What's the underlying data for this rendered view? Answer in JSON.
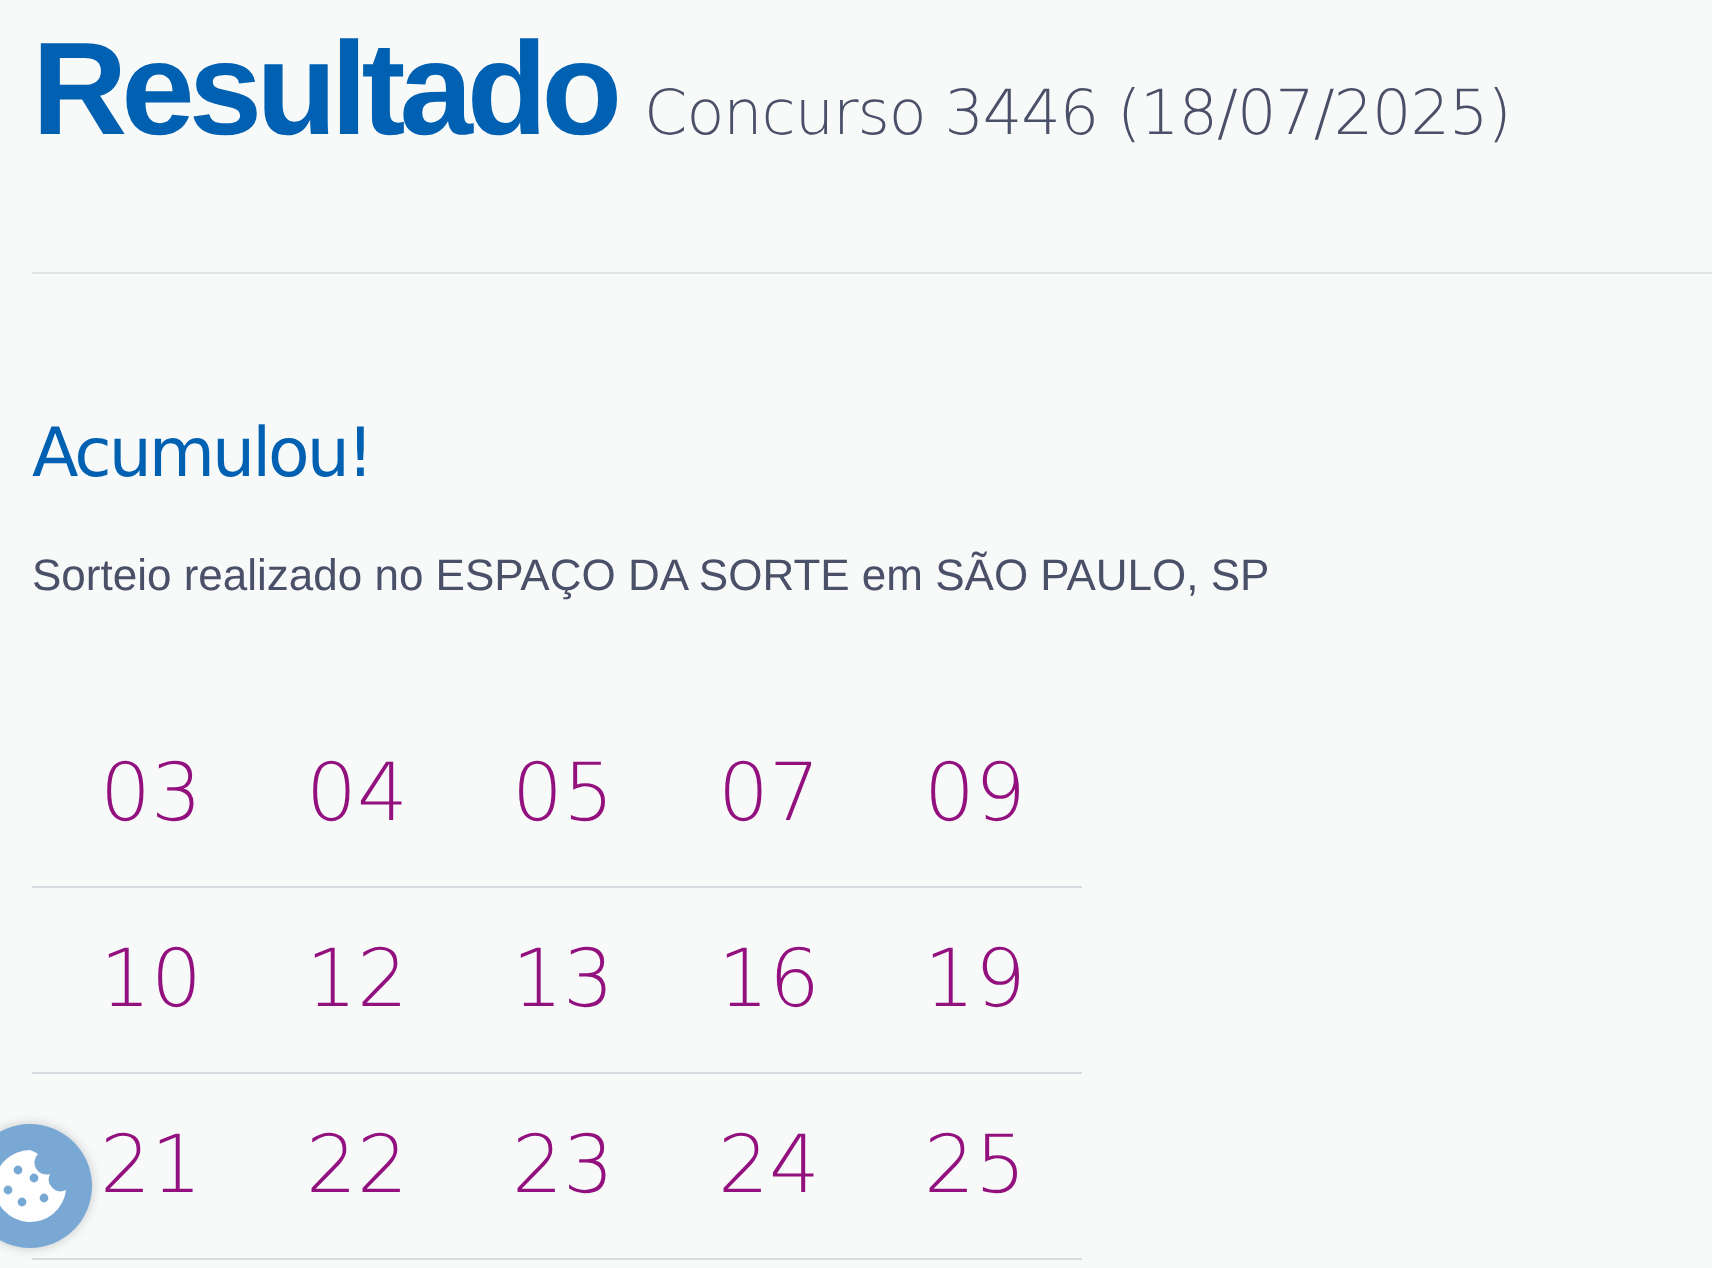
{
  "header": {
    "title": "Resultado",
    "subtitle": "Concurso 3446 (18/07/2025)"
  },
  "status": "Acumulou!",
  "location": "Sorteio realizado no ESPAÇO DA SORTE em SÃO PAULO, SP",
  "numbers": [
    [
      "03",
      "04",
      "05",
      "07",
      "09"
    ],
    [
      "10",
      "12",
      "13",
      "16",
      "19"
    ],
    [
      "21",
      "22",
      "23",
      "24",
      "25"
    ]
  ]
}
